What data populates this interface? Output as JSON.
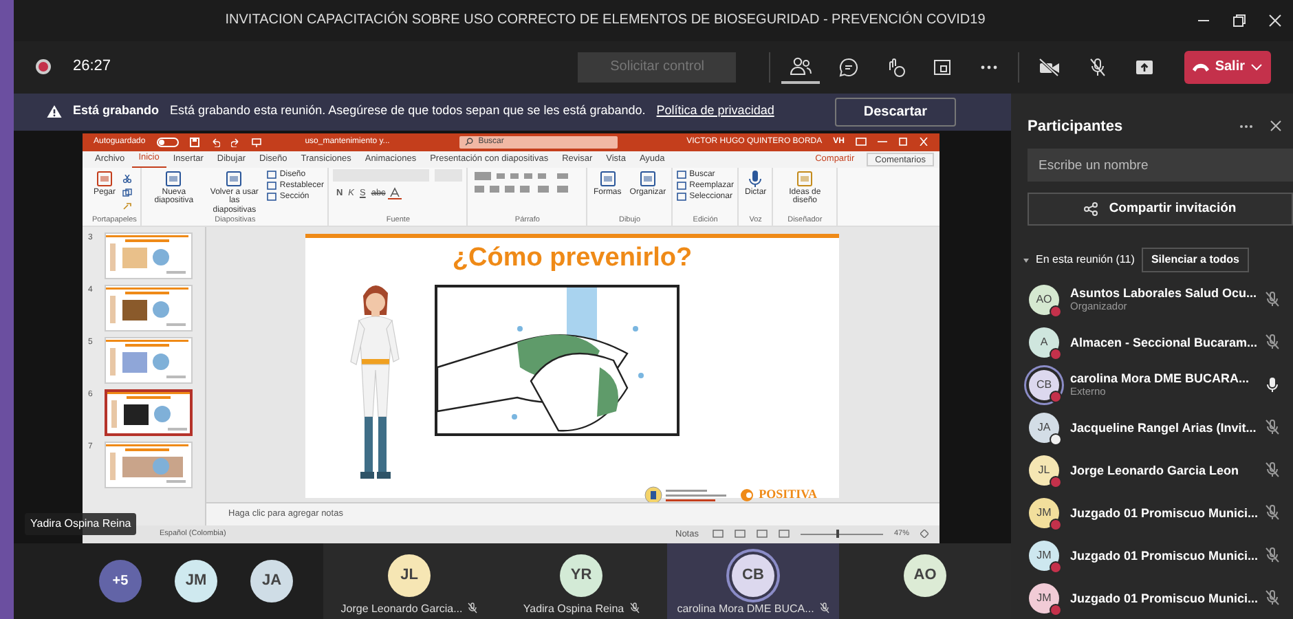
{
  "window": {
    "title": "INVITACION CAPACITACIÓN SOBRE USO CORRECTO DE ELEMENTOS DE BIOSEGURIDAD - PREVENCIÓN COVID19"
  },
  "toolbar": {
    "recording": true,
    "timer": "26:27",
    "request_control": {
      "label": "Solicitar control",
      "disabled": true
    },
    "leave": "Salir"
  },
  "banner": {
    "title": "Está grabando",
    "message": "Está grabando esta reunión. Asegúrese de que todos sepan que se les está grabando.",
    "link": "Política de privacidad",
    "button": "Descartar"
  },
  "presentation": {
    "autosave": {
      "label": "Autoguardado",
      "on": false
    },
    "file": "uso_mantenimiento y...",
    "search": "Buscar",
    "user": "VICTOR HUGO QUINTERO BORDA",
    "user_initials": "VH",
    "tabs": [
      {
        "label": "Archivo",
        "selected": false
      },
      {
        "label": "Inicio",
        "selected": true
      },
      {
        "label": "Insertar",
        "selected": false
      },
      {
        "label": "Dibujar",
        "selected": false
      },
      {
        "label": "Diseño",
        "selected": false
      },
      {
        "label": "Transiciones",
        "selected": false
      },
      {
        "label": "Animaciones",
        "selected": false
      },
      {
        "label": "Presentación con diapositivas",
        "selected": false
      },
      {
        "label": "Revisar",
        "selected": false
      },
      {
        "label": "Vista",
        "selected": false
      },
      {
        "label": "Ayuda",
        "selected": false
      }
    ],
    "share": "Compartir",
    "comments": "Comentarios",
    "groups": [
      {
        "label": "Portapapeles",
        "buttons": [
          {
            "label": "Pegar",
            "kind": "large"
          }
        ]
      },
      {
        "label": "Diapositivas",
        "buttons": [
          {
            "label": "Nueva diapositiva",
            "kind": "large"
          },
          {
            "label": "Volver a usar las diapositivas",
            "kind": "large"
          },
          {
            "label": "Diseño",
            "kind": "small"
          },
          {
            "label": "Restablecer",
            "kind": "small"
          },
          {
            "label": "Sección",
            "kind": "small"
          }
        ]
      },
      {
        "label": "Fuente",
        "buttons": [
          {
            "label": "N",
            "kind": "format"
          },
          {
            "label": "K",
            "kind": "format"
          },
          {
            "label": "S",
            "kind": "format"
          },
          {
            "label": "abc",
            "kind": "format"
          }
        ]
      },
      {
        "label": "Párrafo"
      },
      {
        "label": "Dibujo",
        "buttons": [
          {
            "label": "Formas",
            "kind": "large"
          },
          {
            "label": "Organizar",
            "kind": "large"
          }
        ]
      },
      {
        "label": "Edición",
        "buttons": [
          {
            "label": "Buscar",
            "kind": "small"
          },
          {
            "label": "Reemplazar",
            "kind": "small"
          },
          {
            "label": "Seleccionar",
            "kind": "small"
          }
        ]
      },
      {
        "label": "Voz",
        "buttons": [
          {
            "label": "Dictar",
            "kind": "large"
          }
        ]
      },
      {
        "label": "Diseñador",
        "buttons": [
          {
            "label": "Ideas de diseño",
            "kind": "large"
          }
        ]
      }
    ],
    "thumbnails": [
      {
        "number": "3",
        "selected": false
      },
      {
        "number": "4",
        "selected": false
      },
      {
        "number": "5",
        "selected": false
      },
      {
        "number": "6",
        "selected": true
      },
      {
        "number": "7",
        "selected": false
      }
    ],
    "slide": {
      "title": "¿Cómo prevenirlo?",
      "brand": "POSITIVA"
    },
    "notes": {
      "placeholder": "Haga clic para agregar notas"
    },
    "status": {
      "language": "Español (Colombia)",
      "notes": "Notas",
      "zoom": "47%",
      "zoom_slider": {
        "level": 0.45
      }
    }
  },
  "spotlight_label": "Yadira Ospina Reina",
  "gallery": {
    "overflow": "+5",
    "small": [
      {
        "initials": "JM",
        "color": "#cfe9ef"
      },
      {
        "initials": "JA",
        "color": "#cfdde6"
      }
    ],
    "tiles": [
      {
        "initials": "JL",
        "name": "Jorge Leonardo Garcia...",
        "color": "#f6e6b4",
        "speaking": false
      },
      {
        "initials": "YR",
        "name": "Yadira Ospina Reina",
        "color": "#d3ead6",
        "speaking": false
      },
      {
        "initials": "CB",
        "name": "carolina Mora DME BUCA...",
        "color": "#dcd8ee",
        "speaking": true
      },
      {
        "initials": "AO",
        "color": "#dcebd5",
        "speaking": false
      }
    ]
  },
  "participants": {
    "title": "Participantes",
    "search": {
      "placeholder": "Escribe un nombre"
    },
    "share": "Compartir invitación",
    "section": {
      "label": "En esta reunión (11)",
      "expanded": true
    },
    "mute_all": "Silenciar a todos",
    "people": [
      {
        "initials": "AO",
        "name": "Asuntos Laborales Salud Ocu...",
        "role": "Organizador",
        "color": "#d5e8d0",
        "muted": true,
        "busy": true,
        "speaking": false
      },
      {
        "initials": "A",
        "name": "Almacen - Seccional Bucaram...",
        "color": "#cfe6de",
        "muted": true,
        "busy": true,
        "speaking": false
      },
      {
        "initials": "CB",
        "name": "carolina Mora DME BUCARA...",
        "role": "Externo",
        "color": "#dcd8ee",
        "muted": false,
        "busy": true,
        "speaking": true
      },
      {
        "initials": "JA",
        "name": "Jacqueline Rangel Arias (Invit...",
        "color": "#d3dde6",
        "muted": true,
        "busy": false,
        "speaking": false
      },
      {
        "initials": "JL",
        "name": "Jorge Leonardo Garcia Leon",
        "color": "#f5e6b3",
        "muted": true,
        "busy": true,
        "speaking": false
      },
      {
        "initials": "JM",
        "name": "Juzgado 01 Promiscuo Munici...",
        "color": "#f2df9c",
        "muted": true,
        "busy": true,
        "speaking": false
      },
      {
        "initials": "JM",
        "name": "Juzgado 01 Promiscuo Munici...",
        "color": "#cde7ef",
        "muted": true,
        "busy": true,
        "speaking": false
      },
      {
        "initials": "JM",
        "name": "Juzgado 01 Promiscuo Munici...",
        "color": "#f1cbd6",
        "muted": true,
        "busy": true,
        "speaking": false
      }
    ]
  }
}
